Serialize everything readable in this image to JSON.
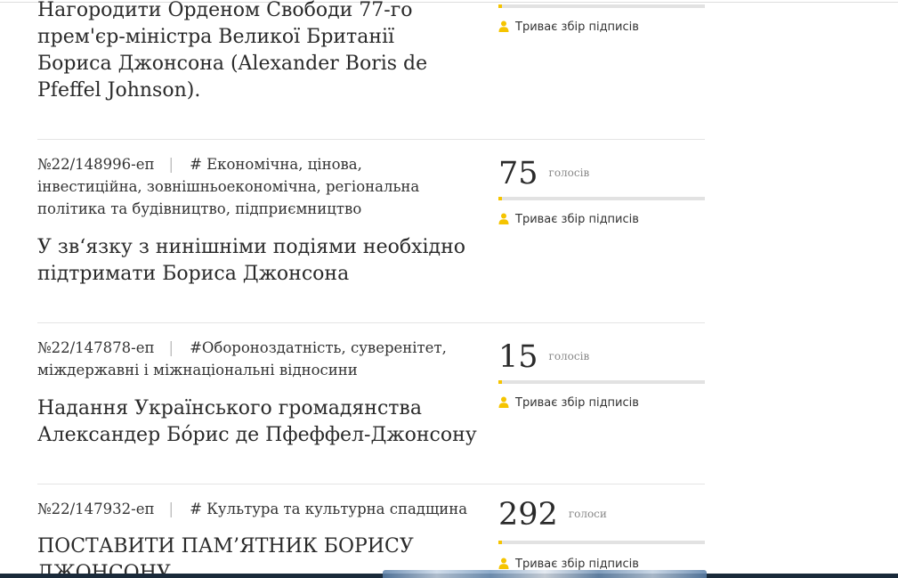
{
  "petitions": [
    {
      "number": "",
      "category": "",
      "title": "Нагородити Орденом Свободи 77-го прем'єр-міністра Великої Британії Бориса Джонсона (Alexander Boris de Pfeffel Johnson).",
      "votes": "",
      "votes_unit": "",
      "status": "Триває збір підписів"
    },
    {
      "number": "№22/148996-еп",
      "category": "# Економічна, цінова, інвестиційна, зовнішньоекономічна, регіональна політика та будівництво, підприємництво",
      "title": "У звʻязку з нинішніми подіями необхідно підтримати Бориса Джонсона",
      "votes": "75",
      "votes_unit": "голосів",
      "status": "Триває збір підписів"
    },
    {
      "number": "№22/147878-еп",
      "category": "#Обороноздатність, суверенітет, міждержавні і міжнаціональні відносини",
      "title": "Надання Українського громадянства Александер Бо́рис де Пфеффел-Джонсону",
      "votes": "15",
      "votes_unit": "голосів",
      "status": "Триває збір підписів"
    },
    {
      "number": "№22/147932-еп",
      "category": "# Культура та культурна спадщина",
      "title": "ПОСТАВИТИ ПАМ’ЯТНИК БОРИСУ ДЖОНСОНУ",
      "votes": "292",
      "votes_unit": "голоси",
      "status": "Триває збір підписів"
    }
  ],
  "icons": {
    "status_icon": "person-icon"
  },
  "colors": {
    "accent": "#f5c400",
    "track": "#e2e2e2",
    "separator": "#e4e4e4"
  }
}
